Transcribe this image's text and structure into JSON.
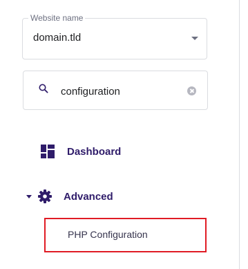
{
  "website_select": {
    "legend": "Website name",
    "value": "domain.tld"
  },
  "search": {
    "value": "configuration"
  },
  "nav": {
    "dashboard_label": "Dashboard",
    "advanced_label": "Advanced",
    "advanced_children": [
      {
        "label": "PHP Configuration",
        "highlighted": true
      }
    ]
  },
  "colors": {
    "nav_text": "#2f1c6a",
    "highlight_border": "#e01b24",
    "field_border": "#dadce0"
  },
  "icons": {
    "search": "search-icon",
    "clear": "clear-icon",
    "select_caret": "chevron-down-icon",
    "dashboard": "dashboard-grid-icon",
    "advanced_caret": "caret-down-icon",
    "advanced": "gear-icon"
  }
}
